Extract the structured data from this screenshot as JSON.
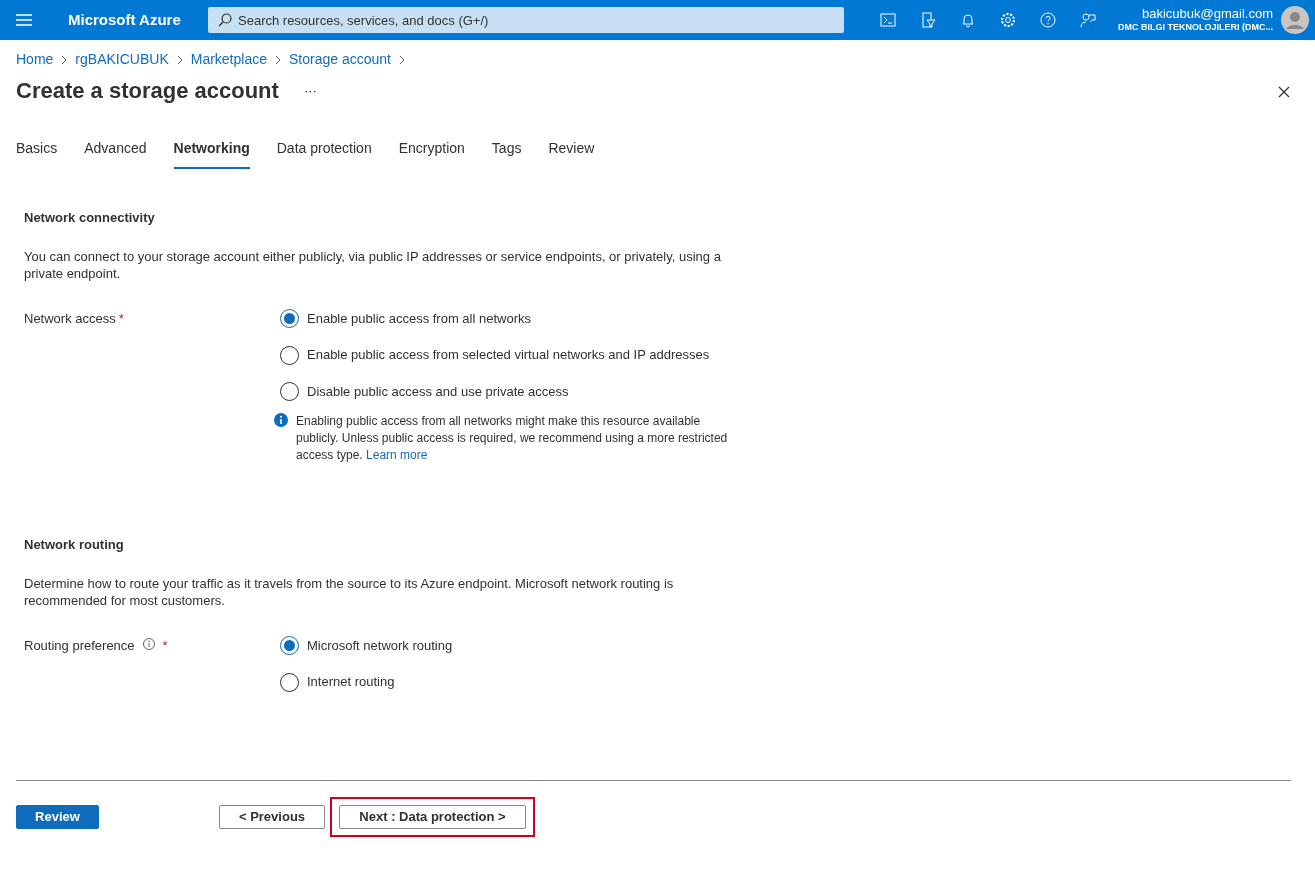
{
  "topbar": {
    "app_title": "Microsoft Azure",
    "search": {
      "placeholder": "Search resources, services, and docs (G+/)"
    },
    "user": {
      "email": "bakicubuk@gmail.com",
      "tenant": "DMC BILGI TEKNOLOJILERI (DMC..."
    }
  },
  "breadcrumb": [
    "Home",
    "rgBAKICUBUK",
    "Marketplace",
    "Storage account"
  ],
  "page": {
    "title": "Create a storage account",
    "more": "···"
  },
  "tabs": [
    {
      "label": "Basics",
      "selected": false
    },
    {
      "label": "Advanced",
      "selected": false
    },
    {
      "label": "Networking",
      "selected": true
    },
    {
      "label": "Data protection",
      "selected": false
    },
    {
      "label": "Encryption",
      "selected": false
    },
    {
      "label": "Tags",
      "selected": false
    },
    {
      "label": "Review",
      "selected": false
    }
  ],
  "sections": [
    {
      "heading": "Network connectivity",
      "description": "You can connect to your storage account either publicly, via public IP addresses or service endpoints, or privately, using a private endpoint.",
      "field": {
        "label": "Network access",
        "required_mark": "*",
        "info": false,
        "options": [
          {
            "label": "Enable public access from all networks",
            "selected": true
          },
          {
            "label": "Enable public access from selected virtual networks and IP addresses",
            "selected": false
          },
          {
            "label": "Disable public access and use private access",
            "selected": false
          }
        ],
        "note": {
          "text": "Enabling public access from all networks might make this resource available publicly. Unless public access is required, we recommend using a more restricted access type.",
          "link": "Learn more"
        }
      }
    },
    {
      "heading": "Network routing",
      "description": "Determine how to route your traffic as it travels from the source to its Azure endpoint. Microsoft network routing is recommended for most customers.",
      "field": {
        "label": "Routing preference",
        "required_mark": "*",
        "info": true,
        "options": [
          {
            "label": "Microsoft network routing",
            "selected": true
          },
          {
            "label": "Internet routing",
            "selected": false
          }
        ]
      }
    }
  ],
  "footer_buttons": [
    {
      "label": "Review",
      "kind": "primary",
      "highlighted": false
    },
    {
      "label": "< Previous",
      "kind": "secondary",
      "highlighted": false
    },
    {
      "label": "Next : Data protection >",
      "kind": "secondary",
      "highlighted": true
    }
  ]
}
